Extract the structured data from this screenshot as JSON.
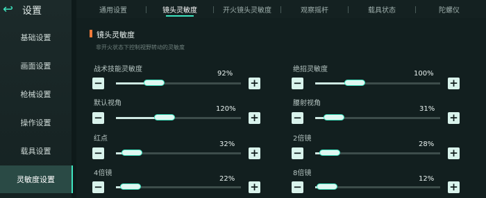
{
  "header": {
    "title": "设置",
    "back_icon": "back-icon"
  },
  "sidebar": {
    "items": [
      {
        "label": "基础设置",
        "active": false
      },
      {
        "label": "画面设置",
        "active": false
      },
      {
        "label": "枪械设置",
        "active": false
      },
      {
        "label": "操作设置",
        "active": false
      },
      {
        "label": "载具设置",
        "active": false
      },
      {
        "label": "灵敏度设置",
        "active": true
      }
    ]
  },
  "tabs": [
    {
      "label": "通用设置",
      "active": false
    },
    {
      "label": "镜头灵敏度",
      "active": true
    },
    {
      "label": "开火镜头灵敏度",
      "active": false
    },
    {
      "label": "观察摇杆",
      "active": false
    },
    {
      "label": "载具状态",
      "active": false
    },
    {
      "label": "陀螺仪",
      "active": false
    }
  ],
  "section": {
    "title": "镜头灵敏度",
    "subtitle": "非开火状态下控制视野转动的灵敏度"
  },
  "sliders": [
    {
      "label": "战术技能灵敏度",
      "value": "92%",
      "level": 0.25
    },
    {
      "label": "绝招灵敏度",
      "value": "100%",
      "level": 0.27
    },
    {
      "label": "默认视角",
      "value": "120%",
      "level": 0.3
    },
    {
      "label": "腰射视角",
      "value": "31%",
      "level": 0.1
    },
    {
      "label": "红点",
      "value": "32%",
      "level": 0.1
    },
    {
      "label": "2倍镜",
      "value": "28%",
      "level": 0.09
    },
    {
      "label": "4倍镜",
      "value": "22%",
      "level": 0.07
    },
    {
      "label": "8倍镜",
      "value": "12%",
      "level": 0.04
    }
  ],
  "colors": {
    "accent": "#3ee6c1",
    "section_marker": "#f07a3a",
    "background": "#0e1a1a"
  }
}
